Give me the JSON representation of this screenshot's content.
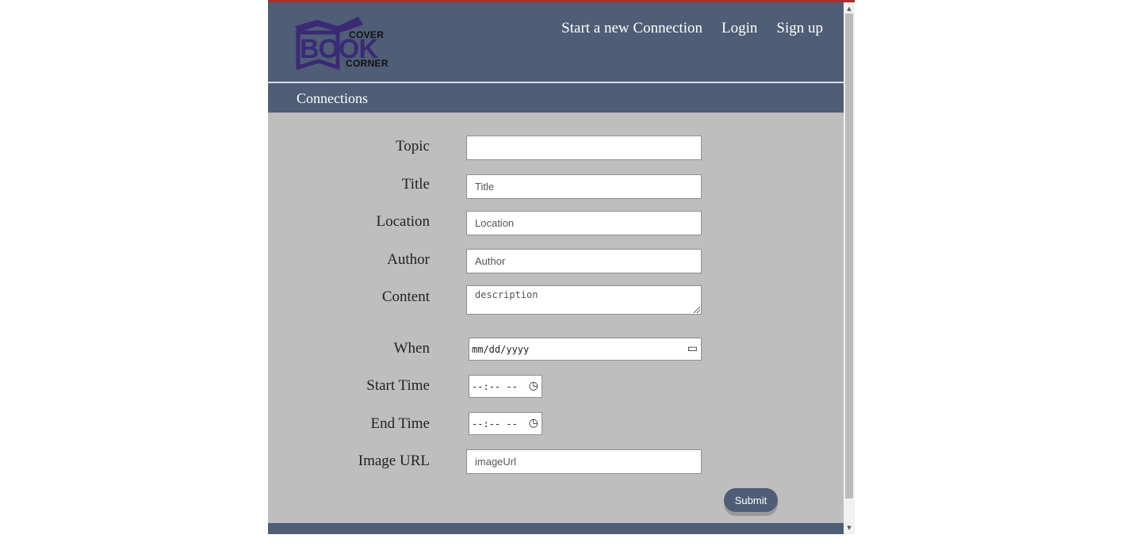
{
  "logo": {
    "word_top": "COVER",
    "word_main": "BOOK",
    "word_bottom": "CORNER"
  },
  "nav": {
    "items": [
      "Start a new Connection",
      "Login",
      "Sign up"
    ]
  },
  "section": {
    "title": "Connections"
  },
  "form": {
    "topic": {
      "label": "Topic",
      "value": "",
      "placeholder": ""
    },
    "title": {
      "label": "Title",
      "placeholder": "Title"
    },
    "location": {
      "label": "Location",
      "placeholder": "Location"
    },
    "author": {
      "label": "Author",
      "placeholder": "Author"
    },
    "content": {
      "label": "Content",
      "placeholder": "description"
    },
    "when": {
      "label": "When",
      "display": "mm/dd/yyyy"
    },
    "start_time": {
      "label": "Start Time",
      "display": "--:-- --"
    },
    "end_time": {
      "label": "End Time",
      "display": "--:-- --"
    },
    "image_url": {
      "label": "Image URL",
      "placeholder": "imageUrl"
    },
    "submit_label": "Submit"
  },
  "icons": {
    "calendar": "calendar-icon",
    "clock": "clock-icon"
  },
  "colors": {
    "header_bg": "#4f5d76",
    "body_bg": "#bdbebd",
    "accent_line": "#a3312f",
    "logo_purple": "#3a2a75"
  }
}
